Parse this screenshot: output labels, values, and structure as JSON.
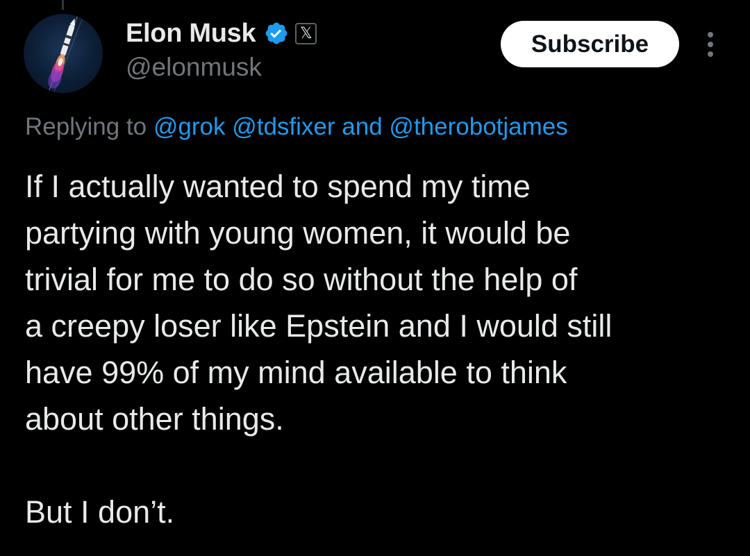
{
  "author": {
    "display_name": "Elon Musk",
    "handle": "@elonmusk",
    "verified_badge_color": "#1d9bf0",
    "verified_icon": "verified-checkmark-icon",
    "affiliate_icon": "x-logo-icon",
    "affiliate_symbol": "𝕏",
    "avatar": "rocket-launch-avatar"
  },
  "actions": {
    "subscribe_label": "Subscribe",
    "more_icon": "more-options-icon"
  },
  "reply": {
    "prefix": "Replying to",
    "mentions": [
      "@grok",
      "@tdsfixer"
    ],
    "conjunction": "and",
    "last_mention": "@therobotjames"
  },
  "tweet": {
    "lines": [
      "If I actually wanted to spend my time",
      "partying with young women, it would be",
      "trivial for me to do so without the help of",
      "a creepy loser like Epstein and I would still",
      "have 99% of my mind available to think",
      "about other things."
    ],
    "closing": "But I don’t."
  },
  "colors": {
    "background": "#000000",
    "text_primary": "#e7e9ea",
    "text_secondary": "#71767b",
    "link": "#1d9bf0",
    "button_bg": "#ffffff"
  }
}
